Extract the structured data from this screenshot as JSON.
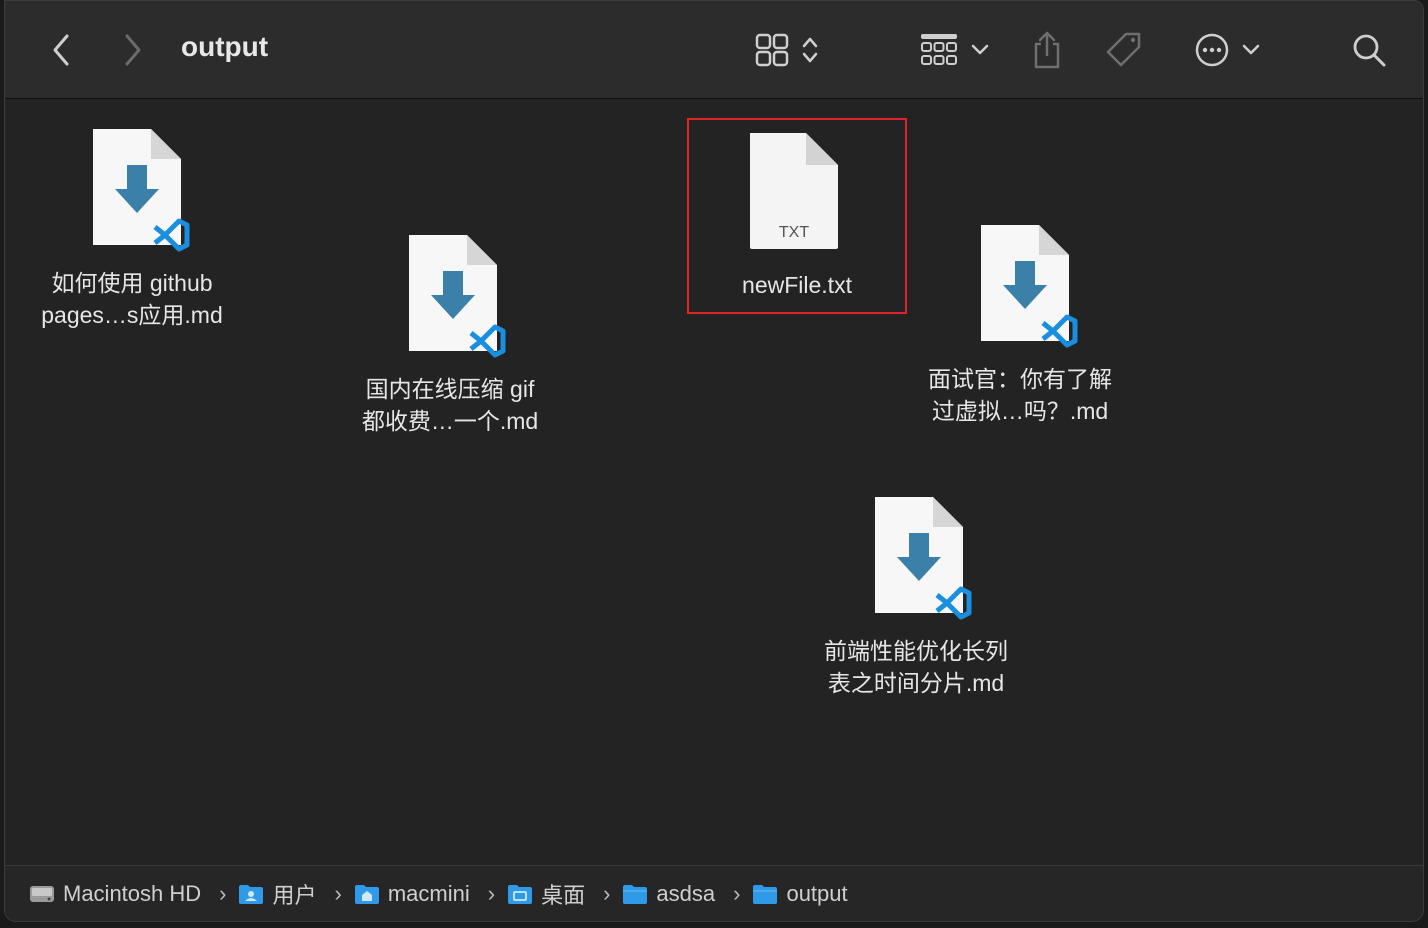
{
  "window": {
    "title": "output"
  },
  "toolbar": {
    "back_icon": "chevron-left-icon",
    "forward_icon": "chevron-right-icon",
    "view_icon": "grid-view-icon",
    "group_icon": "group-icon",
    "share_icon": "share-icon",
    "tag_icon": "tag-icon",
    "more_icon": "ellipsis-circle-icon",
    "search_icon": "search-icon"
  },
  "files": [
    {
      "line1": "如何使用 github",
      "line2": "pages…s应用.md",
      "type": "vscode-md"
    },
    {
      "line1": "国内在线压缩 gif",
      "line2": "都收费…一个.md",
      "type": "vscode-md"
    },
    {
      "line1": "newFile.txt",
      "line2": "",
      "type": "txt",
      "badge": "TXT",
      "selected": true
    },
    {
      "line1": "面试官：你有了解",
      "line2": "过虚拟…吗？.md",
      "type": "vscode-md"
    },
    {
      "line1": "前端性能优化长列",
      "line2": "表之时间分片.md",
      "type": "vscode-md"
    }
  ],
  "pathbar": {
    "items": [
      {
        "label": "Macintosh HD",
        "icon": "hard-drive-icon"
      },
      {
        "label": "用户",
        "icon": "folder-users-icon"
      },
      {
        "label": "macmini",
        "icon": "home-folder-icon"
      },
      {
        "label": "桌面",
        "icon": "desktop-folder-icon"
      },
      {
        "label": "asdsa",
        "icon": "folder-icon"
      },
      {
        "label": "output",
        "icon": "folder-icon"
      }
    ],
    "separator": "›"
  },
  "colors": {
    "accent_folder": "#2f9be8",
    "selection_border": "#e0242b",
    "vscode_blue": "#1a8fe0",
    "arrow_blue": "#3b80a8"
  }
}
